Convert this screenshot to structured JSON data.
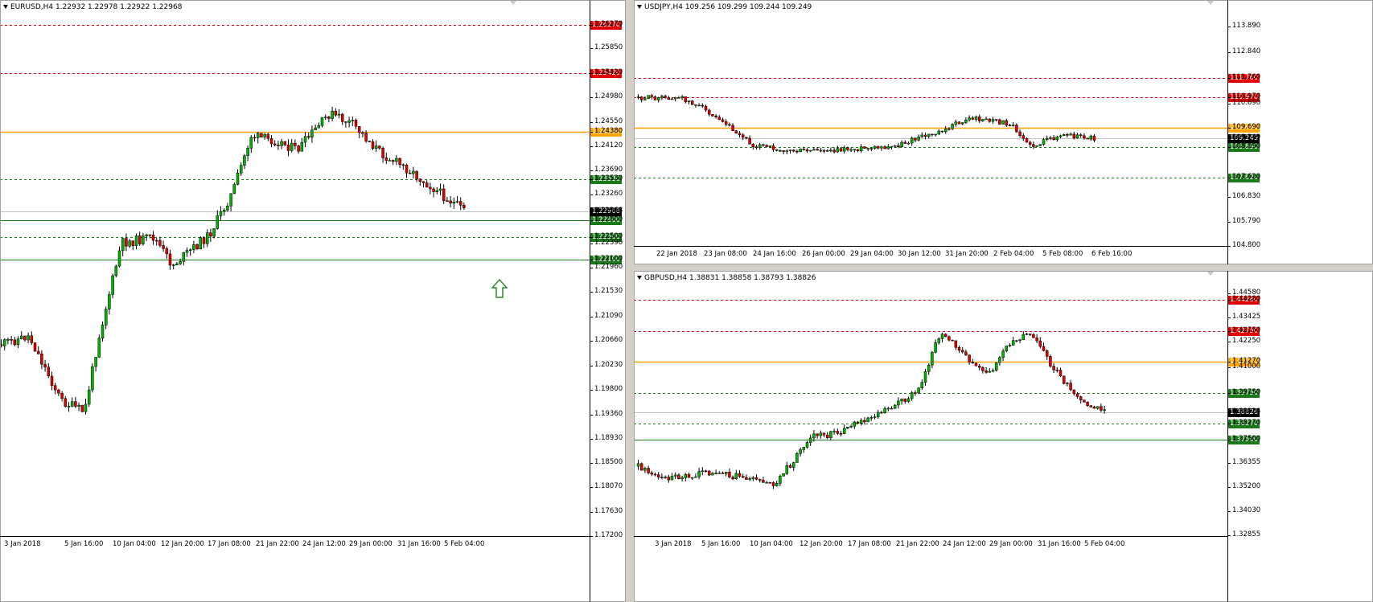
{
  "colors": {
    "bull": "#00b300",
    "bear": "#e00000",
    "wick": "#000000",
    "resistance": "#e00000",
    "support": "#1a7a1a",
    "key_level": "#ffa500",
    "current": "#c0c0c0",
    "arrow": "#2a8a2a"
  },
  "charts": [
    {
      "id": "eurusd",
      "header": "EURUSD,H4  1.22932 1.22978 1.22922 1.22968",
      "price_axis": [
        "1.26270",
        "1.25850",
        "1.25420",
        "1.24980",
        "1.24550",
        "1.24380",
        "1.24120",
        "1.23690",
        "1.23530",
        "1.23260",
        "1.22968",
        "1.22800",
        "1.22390",
        "1.22500",
        "1.22100",
        "1.21960",
        "1.21530",
        "1.21090",
        "1.20660",
        "1.20230",
        "1.19800",
        "1.19360",
        "1.18930",
        "1.18500",
        "1.18070",
        "1.17630",
        "1.17200"
      ],
      "time_axis": [
        "3 Jan 2018",
        "5 Jan 16:00",
        "10 Jan 04:00",
        "12 Jan 20:00",
        "17 Jan 08:00",
        "21 Jan 22:00",
        "24 Jan 12:00",
        "29 Jan 00:00",
        "31 Jan 16:00",
        "5 Feb 04:00"
      ],
      "levels": [
        {
          "price": "1.26270",
          "kind": "resistance"
        },
        {
          "price": "1.25420",
          "kind": "resistance"
        },
        {
          "price": "1.24380",
          "kind": "key_level"
        },
        {
          "price": "1.23530",
          "kind": "support_dashed"
        },
        {
          "price": "1.22968",
          "kind": "current"
        },
        {
          "price": "1.22800",
          "kind": "support"
        },
        {
          "price": "1.22500",
          "kind": "support_dashed"
        },
        {
          "price": "1.22100",
          "kind": "support"
        }
      ],
      "has_up_arrow": true
    },
    {
      "id": "usdjpy",
      "header": "USDJPY,H4  109.256 109.299 109.244 109.249",
      "price_axis": [
        "113.890",
        "112.840",
        "111.760",
        "110.970",
        "110.690",
        "109.690",
        "109.249",
        "108.890",
        "107.620",
        "106.830",
        "105.790",
        "104.800"
      ],
      "time_axis": [
        "22 Jan 2018",
        "23 Jan 08:00",
        "24 Jan 16:00",
        "26 Jan 00:00",
        "29 Jan 04:00",
        "30 Jan 12:00",
        "31 Jan 20:00",
        "2 Feb 04:00",
        "5 Feb 08:00",
        "6 Feb 16:00"
      ],
      "levels": [
        {
          "price": "111.760",
          "kind": "resistance"
        },
        {
          "price": "110.970",
          "kind": "resistance"
        },
        {
          "price": "109.690",
          "kind": "key_level"
        },
        {
          "price": "109.249",
          "kind": "current"
        },
        {
          "price": "108.890",
          "kind": "support_dashed"
        },
        {
          "price": "107.620",
          "kind": "support_dashed"
        }
      ],
      "has_up_arrow": false
    },
    {
      "id": "gbpusd",
      "header": "GBPUSD,H4  1.38831 1.38858 1.38793 1.38826",
      "price_axis": [
        "1.44580",
        "1.44280",
        "1.43425",
        "1.42750",
        "1.42250",
        "1.41270",
        "1.41000",
        "1.39750",
        "1.38826",
        "1.38270",
        "1.37500",
        "1.36355",
        "1.35200",
        "1.34030",
        "1.32855"
      ],
      "time_axis": [
        "3 Jan 2018",
        "5 Jan 16:00",
        "10 Jan 04:00",
        "12 Jan 20:00",
        "17 Jan 08:00",
        "21 Jan 22:00",
        "24 Jan 12:00",
        "29 Jan 00:00",
        "31 Jan 16:00",
        "5 Feb 04:00"
      ],
      "levels": [
        {
          "price": "1.44280",
          "kind": "resistance"
        },
        {
          "price": "1.42750",
          "kind": "resistance"
        },
        {
          "price": "1.41270",
          "kind": "key_level"
        },
        {
          "price": "1.39750",
          "kind": "support_dashed"
        },
        {
          "price": "1.38826",
          "kind": "current"
        },
        {
          "price": "1.38270",
          "kind": "support_dashed"
        },
        {
          "price": "1.37500",
          "kind": "support"
        }
      ],
      "has_up_arrow": false
    }
  ]
}
